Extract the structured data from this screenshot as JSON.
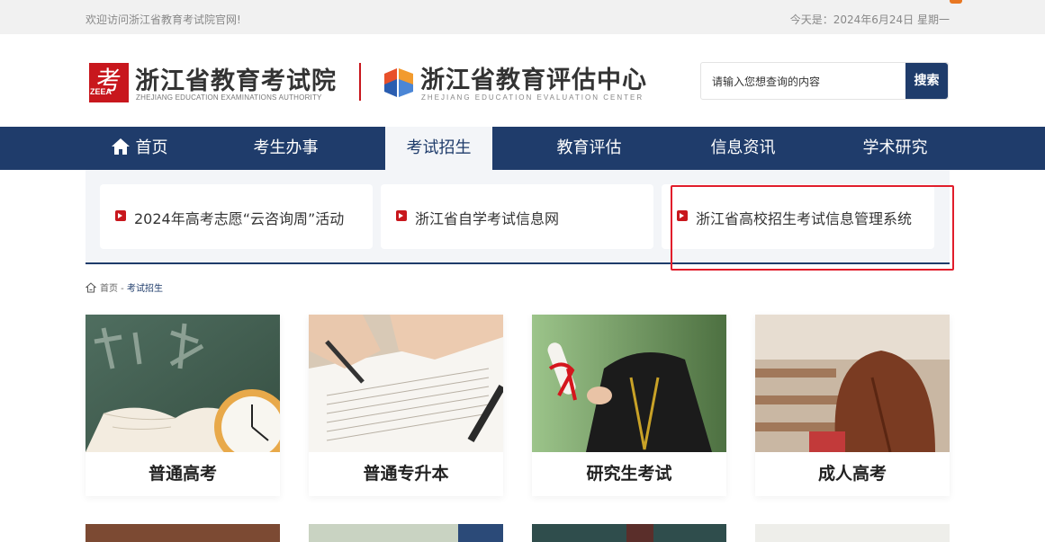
{
  "topbar": {
    "welcome": "欢迎访问浙江省教育考试院官网!",
    "date": "今天是：2024年6月24日 星期一"
  },
  "header": {
    "logo1": {
      "glyph": "考",
      "mini": "ZEEA",
      "title": "浙江省教育考试院",
      "subtitle": "ZHEJIANG EDUCATION EXAMINATIONS AUTHORITY"
    },
    "logo2": {
      "title": "浙江省教育评估中心",
      "subtitle": "ZHEJIANG EDUCATION EVALUATION CENTER"
    },
    "search": {
      "placeholder": "请输入您想查询的内容",
      "button": "搜索"
    }
  },
  "nav": {
    "items": [
      {
        "label": "首页"
      },
      {
        "label": "考生办事"
      },
      {
        "label": "考试招生"
      },
      {
        "label": "教育评估"
      },
      {
        "label": "信息资讯"
      },
      {
        "label": "学术研究"
      }
    ],
    "active_index": 2
  },
  "dropdown": {
    "cards": [
      {
        "label": "2024年高考志愿“云咨询周”活动"
      },
      {
        "label": "浙江省自学考试信息网"
      },
      {
        "label": "浙江省高校招生考试信息管理系统"
      }
    ]
  },
  "breadcrumb": {
    "home": "首页",
    "sep": " - ",
    "current": "考试招生"
  },
  "tiles": [
    {
      "label": "普通高考"
    },
    {
      "label": "普通专升本"
    },
    {
      "label": "研究生考试"
    },
    {
      "label": "成人高考"
    }
  ],
  "colors": {
    "navy": "#1f3c6b",
    "red": "#c8171d",
    "highlight": "#e11d2b"
  }
}
